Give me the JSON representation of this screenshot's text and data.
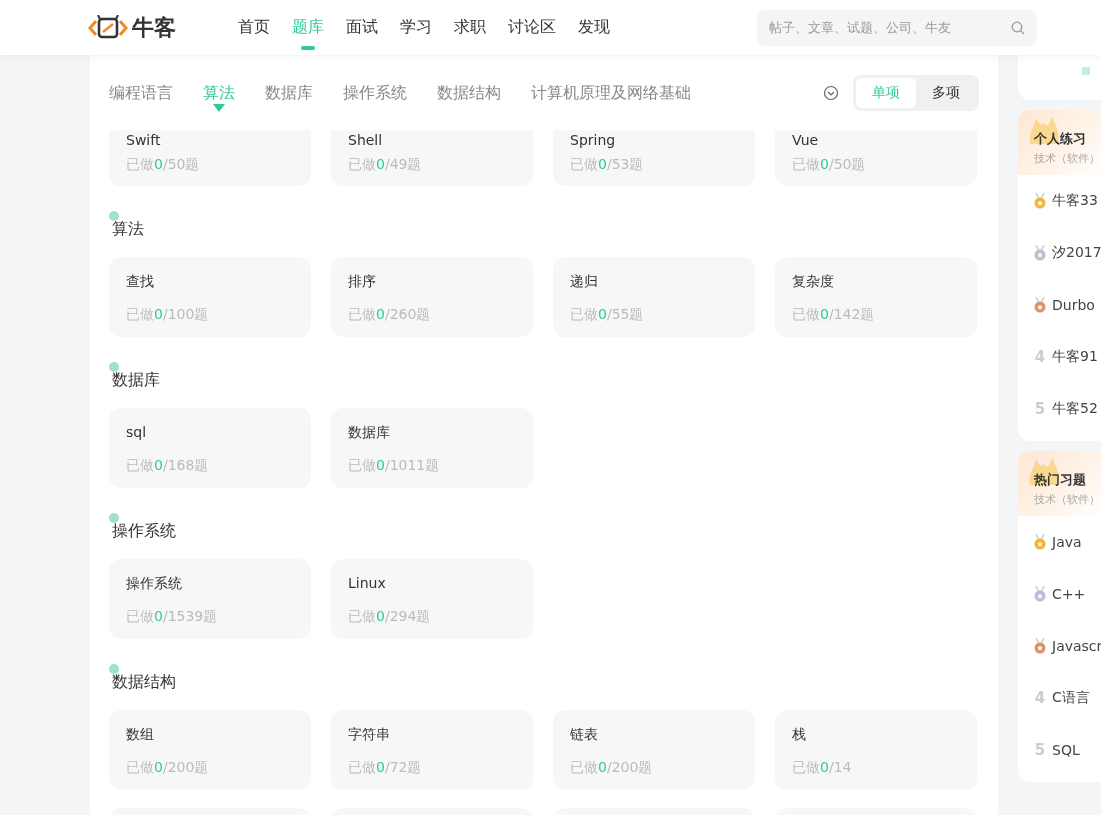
{
  "header": {
    "logo_text": "牛客",
    "nav": [
      {
        "label": "首页",
        "selected": false
      },
      {
        "label": "题库",
        "selected": true
      },
      {
        "label": "面试",
        "selected": false
      },
      {
        "label": "学习",
        "selected": false
      },
      {
        "label": "求职",
        "selected": false
      },
      {
        "label": "讨论区",
        "selected": false
      },
      {
        "label": "发现",
        "selected": false
      }
    ],
    "search": {
      "placeholder": "帖子、文章、试题、公司、牛友"
    }
  },
  "subnav": {
    "tabs": [
      {
        "label": "编程语言",
        "selected": false
      },
      {
        "label": "算法",
        "selected": true
      },
      {
        "label": "数据库",
        "selected": false
      },
      {
        "label": "操作系统",
        "selected": false
      },
      {
        "label": "数据结构",
        "selected": false
      },
      {
        "label": "计算机原理及网络基础",
        "selected": false
      }
    ],
    "mode_toggle": [
      {
        "label": "单项",
        "selected": true
      },
      {
        "label": "多项",
        "selected": false
      }
    ]
  },
  "top_row": [
    {
      "name": "Swift",
      "prefix": "已做",
      "done": "0",
      "rest": "/50题"
    },
    {
      "name": "Shell",
      "prefix": "已做",
      "done": "0",
      "rest": "/49题"
    },
    {
      "name": "Spring",
      "prefix": "已做",
      "done": "0",
      "rest": "/53题"
    },
    {
      "name": "Vue",
      "prefix": "已做",
      "done": "0",
      "rest": "/50题"
    }
  ],
  "sections": [
    {
      "title": "算法",
      "cards": [
        {
          "name": "查找",
          "prefix": "已做",
          "done": "0",
          "rest": "/100题"
        },
        {
          "name": "排序",
          "prefix": "已做",
          "done": "0",
          "rest": "/260题"
        },
        {
          "name": "递归",
          "prefix": "已做",
          "done": "0",
          "rest": "/55题"
        },
        {
          "name": "复杂度",
          "prefix": "已做",
          "done": "0",
          "rest": "/142题"
        }
      ]
    },
    {
      "title": "数据库",
      "cards": [
        {
          "name": "sql",
          "prefix": "已做",
          "done": "0",
          "rest": "/168题"
        },
        {
          "name": "数据库",
          "prefix": "已做",
          "done": "0",
          "rest": "/1011题"
        }
      ]
    },
    {
      "title": "操作系统",
      "cards": [
        {
          "name": "操作系统",
          "prefix": "已做",
          "done": "0",
          "rest": "/1539题"
        },
        {
          "name": "Linux",
          "prefix": "已做",
          "done": "0",
          "rest": "/294题"
        }
      ]
    },
    {
      "title": "数据结构",
      "cards": [
        {
          "name": "数组",
          "prefix": "已做",
          "done": "0",
          "rest": "/200题"
        },
        {
          "name": "字符串",
          "prefix": "已做",
          "done": "0",
          "rest": "/72题"
        },
        {
          "name": "链表",
          "prefix": "已做",
          "done": "0",
          "rest": "/200题"
        },
        {
          "name": "栈",
          "prefix": "已做",
          "done": "0",
          "rest": "/14"
        }
      ]
    }
  ],
  "sidebar": {
    "rankings": [
      {
        "title": "个人练习",
        "subtitle": "技术（软件）",
        "entries": [
          {
            "kind": "medal",
            "color": "#f2b634",
            "name": "牛客33"
          },
          {
            "kind": "medal",
            "color": "#b9bfd3",
            "name": "汐2017"
          },
          {
            "kind": "medal",
            "color": "#dc9467",
            "name": "Durbo"
          },
          {
            "kind": "number",
            "rank": "4",
            "name": "牛客91"
          },
          {
            "kind": "number",
            "rank": "5",
            "name": "牛客52"
          }
        ]
      },
      {
        "title": "热门习题",
        "subtitle": "技术（软件）",
        "entries": [
          {
            "kind": "medal",
            "color": "#f2b634",
            "name": "Java"
          },
          {
            "kind": "medal",
            "color": "#b9bfd3",
            "name": "C++"
          },
          {
            "kind": "medal",
            "color": "#dc9467",
            "name": "Javascr"
          },
          {
            "kind": "number",
            "rank": "4",
            "name": "C语言"
          },
          {
            "kind": "number",
            "rank": "5",
            "name": "SQL"
          }
        ]
      }
    ]
  }
}
